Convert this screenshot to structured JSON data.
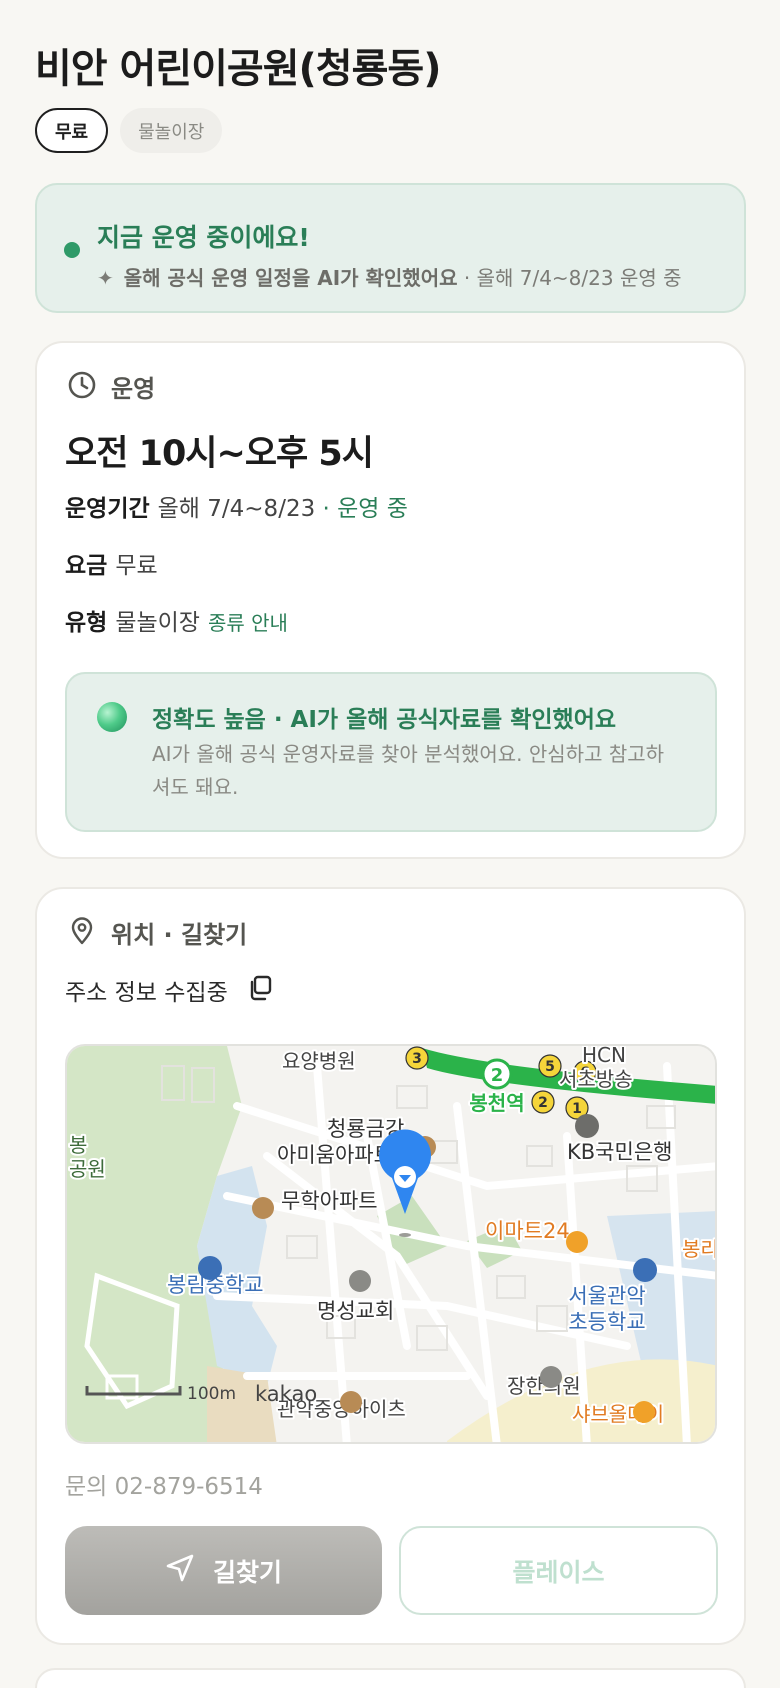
{
  "header": {
    "title": "비안 어린이공원(청룡동)"
  },
  "tags": [
    {
      "label": "무료"
    },
    {
      "label": "물놀이장"
    }
  ],
  "status": {
    "title": "지금 운영 중이에요!",
    "sparkle": "✦",
    "sub_strong": "올해 공식 운영 일정을 AI가 확인했어요",
    "sub_rest": " · 올해 7/4~8/23 운영 중",
    "accent_color": "#2a7e57"
  },
  "operation": {
    "section_label": "운영",
    "icon": "clock-icon",
    "hours": "오전 10시~오후 5시",
    "period_key": "운영기간",
    "period_value": "올해 7/4~8/23",
    "period_status": " · 운영 중",
    "fee_key": "요금",
    "fee_value": "무료",
    "type_key": "유형",
    "type_value": "물놀이장",
    "type_link": "종류 안내",
    "ai": {
      "title": "정확도 높음 · AI가 올해 공식자료를 확인했어요",
      "body": "AI가 올해 공식 운영자료를 찾아 분석했어요. 안심하고 참고하셔도 돼요."
    }
  },
  "location": {
    "section_label": "위치 · 길찾기",
    "icon": "map-pin-icon",
    "address": "주소 정보 수집중",
    "copy_icon": "copy-icon",
    "map": {
      "labels": {
        "hospital": "요양병원",
        "hcn": "HCN",
        "hcn2": "서초방송",
        "station": "봉천역",
        "apt1a": "청룡금강",
        "apt1b": "아미움아파트",
        "bank": "KB국민은행",
        "park1": "봉",
        "park2": "공원",
        "apt2": "무학아파트",
        "mart": "이마트24",
        "school1": "봉림중학교",
        "school2a": "서울관악",
        "school2b": "초등학교",
        "church": "명성교회",
        "clinic": "장한의원",
        "heights": "관악중앙하이츠",
        "scale": "100m",
        "brand": "kakao",
        "shop": "샤브올데이",
        "edge": "봉리"
      },
      "line_number": "2",
      "exits": [
        "3",
        "5",
        "6",
        "2",
        "1"
      ]
    },
    "phone": "문의 02-879-6514",
    "route_button": "길찾기",
    "place_button": "플레이스"
  }
}
